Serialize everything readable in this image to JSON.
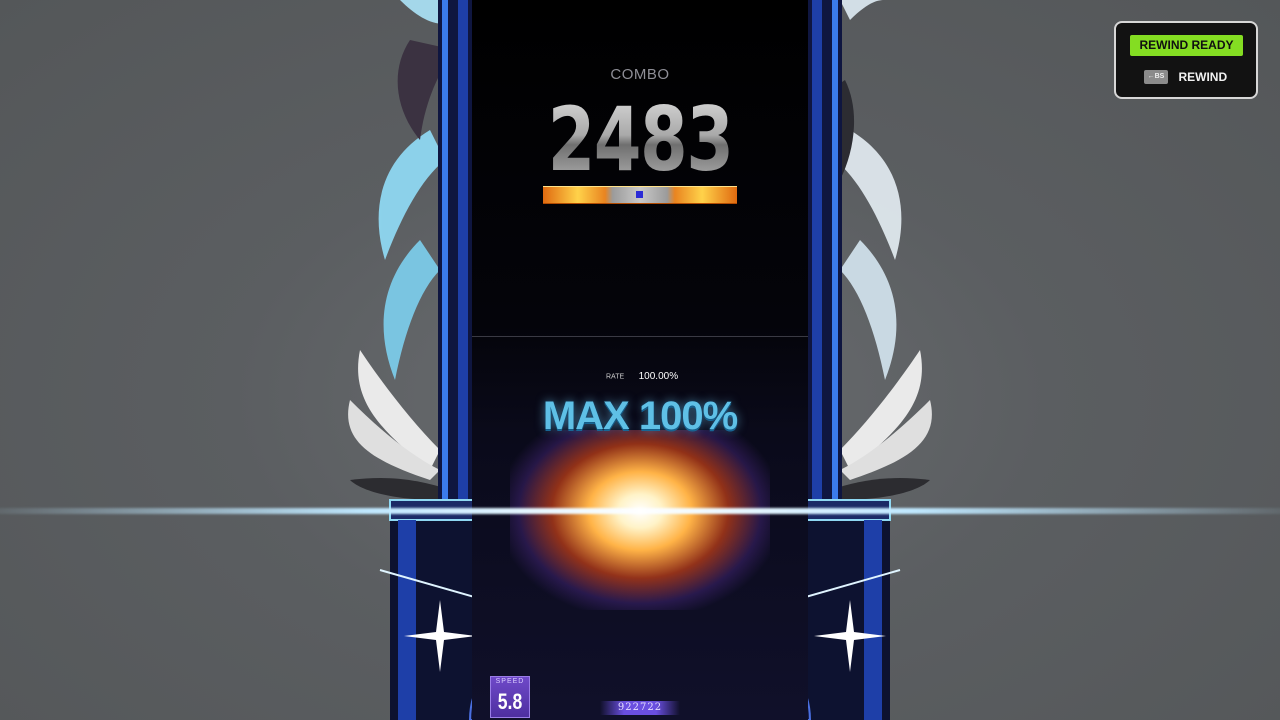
{
  "combo": {
    "label": "COMBO",
    "value": "2483"
  },
  "rate": {
    "label": "RATE",
    "value": "100.00%"
  },
  "judgement": {
    "text": "MAX 100%"
  },
  "speed": {
    "label": "SPEED",
    "value": "5.8"
  },
  "score": {
    "value": "922722"
  },
  "rewind": {
    "status": "REWIND READY",
    "key": "←BS",
    "label": "REWIND"
  },
  "colors": {
    "background": "#5d6062",
    "accent_blue": "#5fc0e6",
    "rewind_green": "#84dd22",
    "speed_purple": "#6f49c9"
  }
}
